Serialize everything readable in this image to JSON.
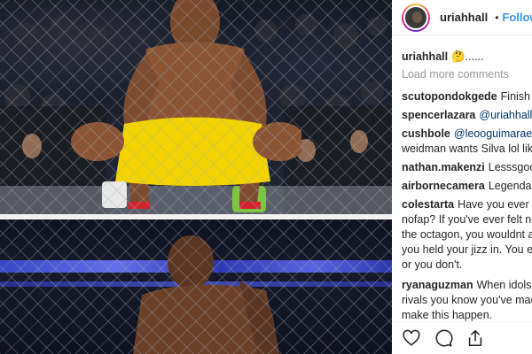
{
  "header": {
    "username": "uriahhall",
    "separator": "•",
    "follow_label": "Follow"
  },
  "caption": {
    "username": "uriahhall",
    "text": "🤔......"
  },
  "load_more": "Load more comments",
  "comments": [
    {
      "user": "scutopondokgede",
      "mention": "",
      "text": "Finish HI"
    },
    {
      "user": "spencerlazara",
      "mention": "@uriahhall",
      "text": "🏆"
    },
    {
      "user": "cushbole",
      "mention": "@leooguimaraess",
      "text": ""
    },
    {
      "user": "",
      "mention": "",
      "text": "weidman wants Silva lol like"
    },
    {
      "user": "nathan.makenzi",
      "mention": "",
      "text": "Lesssgooo"
    },
    {
      "user": "airbornecamera",
      "mention": "",
      "text": "Legendary"
    },
    {
      "user": "colestarta",
      "mention": "",
      "text": "Have you ever lo"
    },
    {
      "user": "",
      "mention": "",
      "text": "nofap? If you've ever felt ne"
    },
    {
      "user": "",
      "mention": "",
      "text": "the octagon, you wouldnt a"
    },
    {
      "user": "",
      "mention": "",
      "text": "you held your jizz in. You eit"
    },
    {
      "user": "",
      "mention": "",
      "text": "or you don't."
    },
    {
      "user": "ryanaguzman",
      "mention": "",
      "text": "When idols b"
    },
    {
      "user": "",
      "mention": "",
      "text": "rivals you know you've mad"
    },
    {
      "user": "",
      "mention": "",
      "text": "make this happen."
    }
  ],
  "colors": {
    "follow": "#3897f0",
    "mention": "#003569",
    "muted": "#999999",
    "shorts_yellow": "#f3d400"
  },
  "icons": [
    "heart-icon",
    "comment-icon",
    "share-icon",
    "verified-badge-icon"
  ]
}
